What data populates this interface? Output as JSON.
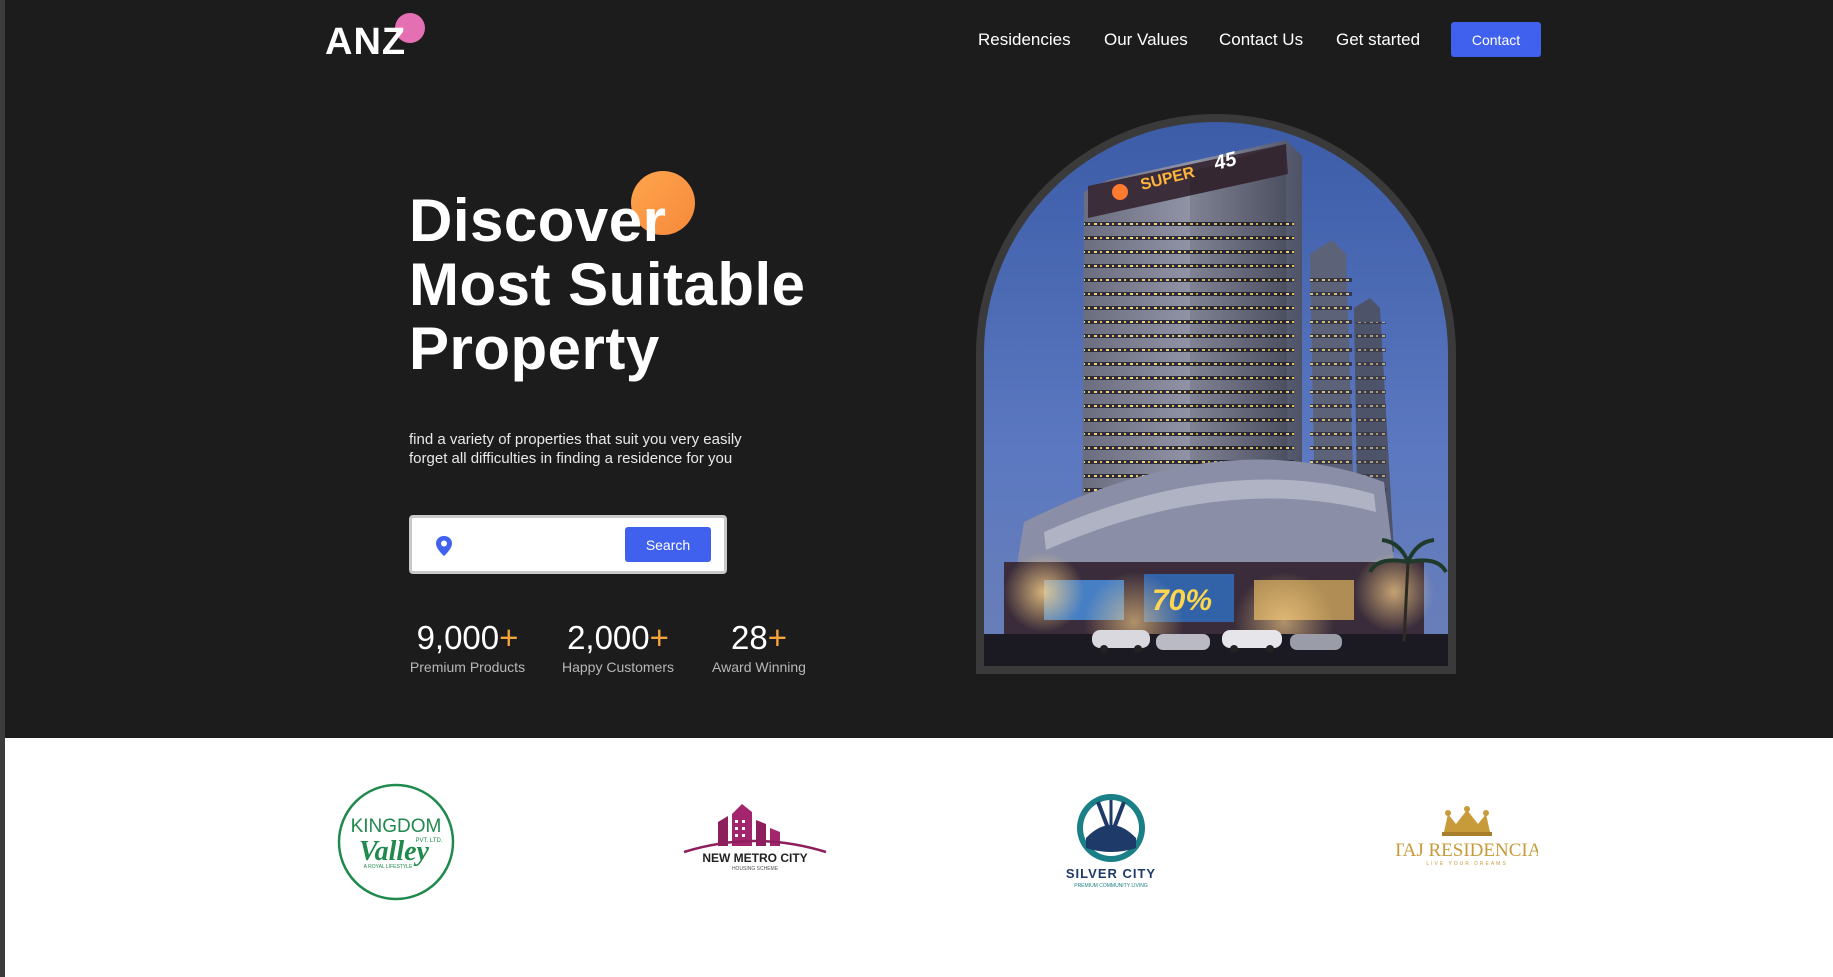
{
  "brand": {
    "logo_text": "ANZ"
  },
  "nav": {
    "items": [
      "Residencies",
      "Our Values",
      "Contact Us",
      "Get started"
    ],
    "contact_button": "Contact"
  },
  "hero": {
    "headline": [
      "Discover",
      "Most Suitable",
      "Property"
    ],
    "subtext": [
      "find a variety of properties that suit you very easily",
      "forget all difficulties in finding a residence for you"
    ],
    "search": {
      "placeholder": "",
      "value": "",
      "button": "Search"
    },
    "stats": [
      {
        "number": "9,000",
        "suffix": "+",
        "label": "Premium Products"
      },
      {
        "number": "2,000",
        "suffix": "+",
        "label": "Happy Customers"
      },
      {
        "number": "28",
        "suffix": "+",
        "label": "Award Winning"
      }
    ],
    "image_sign": {
      "brand": "SUPER",
      "number": "45"
    }
  },
  "partners": [
    {
      "name_lines": [
        "KINGDOM",
        "Valley"
      ],
      "tag": "PVT. LTD.",
      "tagline": "A ROYAL LIFESTYLE"
    },
    {
      "name": "NEW METRO CITY",
      "tagline": "HOUSING SCHEME"
    },
    {
      "name": "SILVER CITY",
      "tagline": "PREMIUM COMMUNITY LIVING"
    },
    {
      "name": "TAJ RESIDENCIA",
      "tagline": "LIVE YOUR DREAMS"
    }
  ],
  "colors": {
    "hero_bg": "#1d1c1c",
    "accent_blue": "#4061ee",
    "accent_orange": "#f7a33b",
    "logo_pink": "#e46fb2",
    "kingdom_green": "#1f8a4c",
    "metro_magenta": "#8c1f5c",
    "silver_teal": "#1a7f86",
    "taj_gold": "#c79a3a"
  },
  "icons": [
    "location-pin-icon"
  ]
}
